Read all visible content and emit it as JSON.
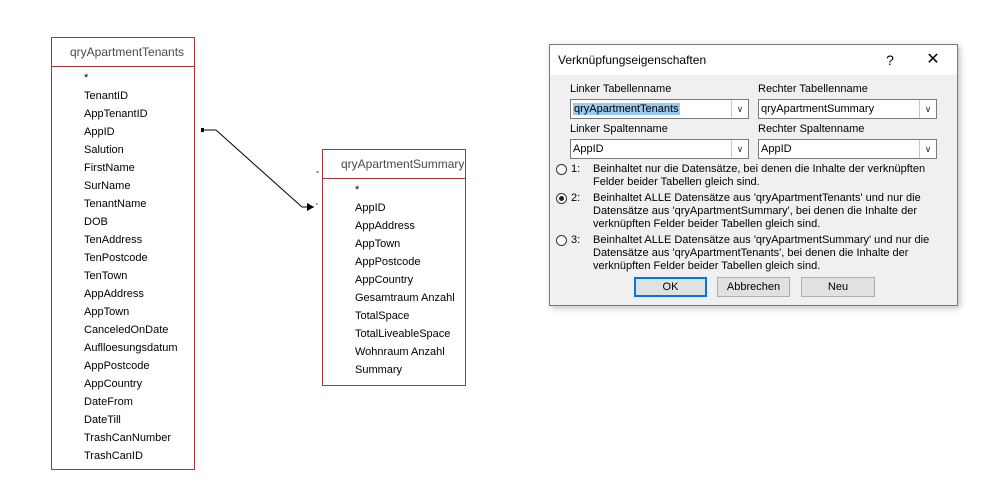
{
  "table_left": {
    "title": "qryApartmentTenants",
    "fields": [
      "*",
      "TenantID",
      "AppTenantID",
      "AppID",
      "Salution",
      "FirstName",
      "SurName",
      "TenantName",
      "DOB",
      "TenAddress",
      "TenPostcode",
      "TenTown",
      "AppAddress",
      "AppTown",
      "CanceledOnDate",
      "Auflloesungsdatum",
      "AppPostcode",
      "AppCountry",
      "DateFrom",
      "DateTill",
      "TrashCanNumber",
      "TrashCanID"
    ]
  },
  "table_right": {
    "title": "qryApartmentSummary",
    "fields": [
      "*",
      "AppID",
      "AppAddress",
      "AppTown",
      "AppPostcode",
      "AppCountry",
      "Gesamtraum Anzahl",
      "TotalSpace",
      "TotalLiveableSpace",
      "Wohnraum Anzahl",
      "Summary"
    ]
  },
  "dialog": {
    "title": "Verknüpfungseigenschaften",
    "help": "?",
    "close": "✕",
    "left_table_label": "Linker Tabellenname",
    "left_table_value": "qryApartmentTenants",
    "right_table_label": "Rechter Tabellenname",
    "right_table_value": "qryApartmentSummary",
    "left_column_label": "Linker Spaltenname",
    "left_column_value": "AppID",
    "right_column_label": "Rechter Spaltenname",
    "right_column_value": "AppID",
    "options": [
      {
        "num": "1:",
        "text": "Beinhaltet nur die Datensätze, bei denen die Inhalte der verknüpften Felder beider Tabellen gleich sind.",
        "selected": false
      },
      {
        "num": "2:",
        "text": "Beinhaltet ALLE Datensätze aus 'qryApartmentTenants' und nur die Datensätze aus 'qryApartmentSummary', bei denen die Inhalte der verknüpften Felder beider Tabellen gleich sind.",
        "selected": true
      },
      {
        "num": "3:",
        "text": "Beinhaltet ALLE Datensätze aus 'qryApartmentSummary' und nur die Datensätze aus 'qryApartmentTenants', bei denen die Inhalte der verknüpften Felder beider Tabellen gleich sind.",
        "selected": false
      }
    ],
    "ok_label": "OK",
    "cancel_label": "Abbrechen",
    "new_label": "Neu"
  }
}
